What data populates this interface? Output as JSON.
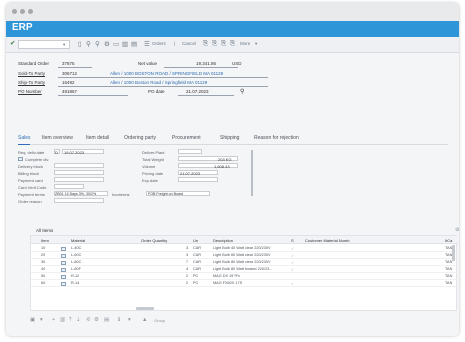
{
  "window": {
    "title": "ERP"
  },
  "toolbar": {
    "select_value": "",
    "icons": [
      "save-icon",
      "search-icon",
      "find-icon",
      "settings-icon",
      "copy-icon",
      "delete-icon",
      "print-icon"
    ],
    "orders_label": "Orders",
    "cancel_label": "Cancel",
    "more_label": "More"
  },
  "header": {
    "standard_order_label": "Standard Order",
    "standard_order_value": "37875",
    "net_value_label": "Net value",
    "net_value": "19,341.86",
    "currency": "USD",
    "sold_to_label": "Sold-To Party",
    "sold_to_value": "306712",
    "sold_to_address": "Allen / 1000 BOSTON ROAD / SPRINGFIELD MA 01129",
    "ship_to_label": "Ship-To Party",
    "ship_to_value": "16492",
    "ship_to_address": "Allen / 1000 Boston Road / Springfield MA 01129",
    "po_number_label": "PO Number",
    "po_number_value": "491867",
    "po_date_label": "PO date",
    "po_date_value": "21.07.2023"
  },
  "tabs": [
    {
      "label": "Sales",
      "active": true
    },
    {
      "label": "Item overview",
      "active": false
    },
    {
      "label": "Item detail",
      "active": false
    },
    {
      "label": "Ordering party",
      "active": false
    },
    {
      "label": "Procurement",
      "active": false
    },
    {
      "label": "Shipping",
      "active": false
    },
    {
      "label": "Reason for rejection",
      "active": false
    }
  ],
  "sales": {
    "req_deliv_date_label": "Req. deliv.date",
    "req_deliv_date_prefix": "D",
    "req_deliv_date": "19.07.2023",
    "complete_dlv_label": "Complete dlv.",
    "delivery_block_label": "Delivery block",
    "billing_block_label": "Billing block",
    "payment_card_label": "Payment card",
    "card_verif_label": "Card Verif.Code",
    "payment_terms_label": "Payment terms",
    "payment_terms_value": "ZB01 14 Days 3%, 30/2%",
    "order_reason_label": "Order reason",
    "deliver_plant_label": "Deliver.Plant",
    "total_weight_label": "Total Weight",
    "total_weight_value": "203 KG",
    "volume_label": "Volume",
    "volume_value": "1,608.43",
    "pricing_date_label": "Pricing date",
    "pricing_date_value": "21.07.2023",
    "exp_date_label": "Exp.date",
    "incoterms_label": "Incoterms",
    "incoterms_value": "FOB Freight on Board"
  },
  "items": {
    "title": "All Items",
    "columns": [
      "Item",
      "Material",
      "Order Quantity",
      "Un",
      "Description",
      "S",
      "Customer Material Numb",
      "ItCa"
    ],
    "rows": [
      {
        "item": "10",
        "material": "L-40C",
        "qty": "3",
        "un": "CAR",
        "description": "Light Bulb 40 Watt clear 220/230V",
        "itca": "TAN"
      },
      {
        "item": "20",
        "material": "L-60C",
        "qty": "3",
        "un": "CAR",
        "description": "Light Bulb 60 Watt clear 220/230V",
        "itca": "TAN"
      },
      {
        "item": "30",
        "material": "L-80C",
        "qty": "7",
        "un": "CAR",
        "description": "Light Bulb 80 Watt clear 220/230V",
        "itca": "TAN"
      },
      {
        "item": "40",
        "material": "L-80F",
        "qty": "4",
        "un": "CAR",
        "description": "Light Bulb 80 Watt frosted 220/23...",
        "itca": "TAN"
      },
      {
        "item": "50",
        "material": "R-12",
        "qty": "2",
        "un": "PC",
        "description": "MAG DX 15\"/Fx",
        "itca": "TAN"
      },
      {
        "item": "60",
        "material": "R-14",
        "qty": "2",
        "un": "PC",
        "description": "MAG FX60X 17S",
        "itca": "TAN"
      }
    ]
  },
  "bottom": {
    "group_label": "Group",
    "icons": [
      "details-icon",
      "add-icon",
      "delete-icon",
      "sort-asc-icon",
      "sort-desc-icon",
      "filter-icon",
      "config-icon",
      "pricing-icon",
      "info-icon",
      "group-icon"
    ]
  }
}
